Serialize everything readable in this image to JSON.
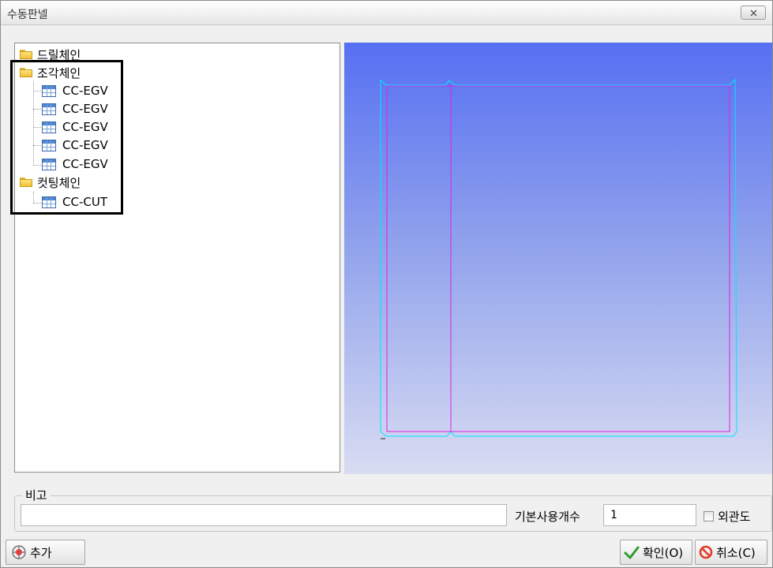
{
  "window": {
    "title": "수동판넬"
  },
  "tree": {
    "groups": [
      {
        "label": "드릴체인",
        "items": []
      },
      {
        "label": "조각체인",
        "items": [
          "CC-EGV",
          "CC-EGV",
          "CC-EGV",
          "CC-EGV",
          "CC-EGV"
        ]
      },
      {
        "label": "컷팅체인",
        "items": [
          "CC-CUT"
        ]
      }
    ]
  },
  "note": {
    "label": "비고",
    "value": ""
  },
  "default_count": {
    "label": "기본사용개수",
    "value": "1"
  },
  "outline_check": {
    "label": "외관도",
    "checked": false
  },
  "buttons": {
    "add": "추가",
    "ok": "확인(O)",
    "cancel": "취소(C)"
  },
  "colors": {
    "preview_top": "#5670f2",
    "preview_bottom": "#d8dcf2",
    "panel_outline": "#00e6ff",
    "panel_inner": "#e020e0"
  }
}
